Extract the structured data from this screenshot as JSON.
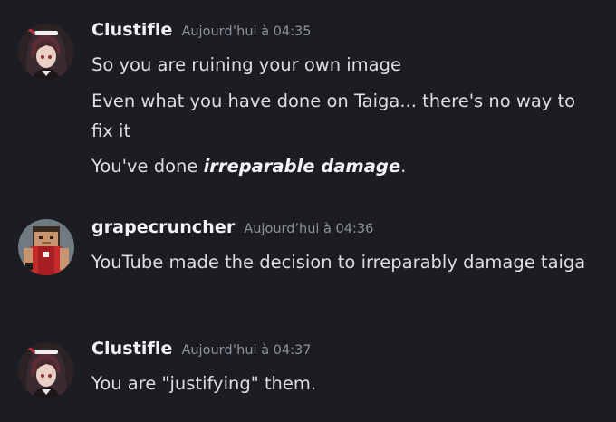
{
  "messages": [
    {
      "username": "Clustifle",
      "timestamp": "Aujourd’hui à 04:35",
      "lines": {
        "line1": "So you are ruining your own image",
        "line2": "Even what you have done on Taiga... there's no way to fix it",
        "line3_prefix": "You've done ",
        "line3_emphasis": "irreparable damage",
        "line3_suffix": "."
      }
    },
    {
      "username": "grapecruncher",
      "timestamp": "Aujourd’hui à 04:36",
      "lines": {
        "line1": "YouTube made the decision to irreparably damage taiga"
      }
    },
    {
      "username": "Clustifle",
      "timestamp": "Aujourd’hui à 04:37",
      "lines": {
        "line1": "You are \"justifying\" them."
      }
    }
  ],
  "avatars": {
    "clustifle": "anime-character-avatar",
    "grapecruncher": "minecraft-skin-avatar"
  }
}
